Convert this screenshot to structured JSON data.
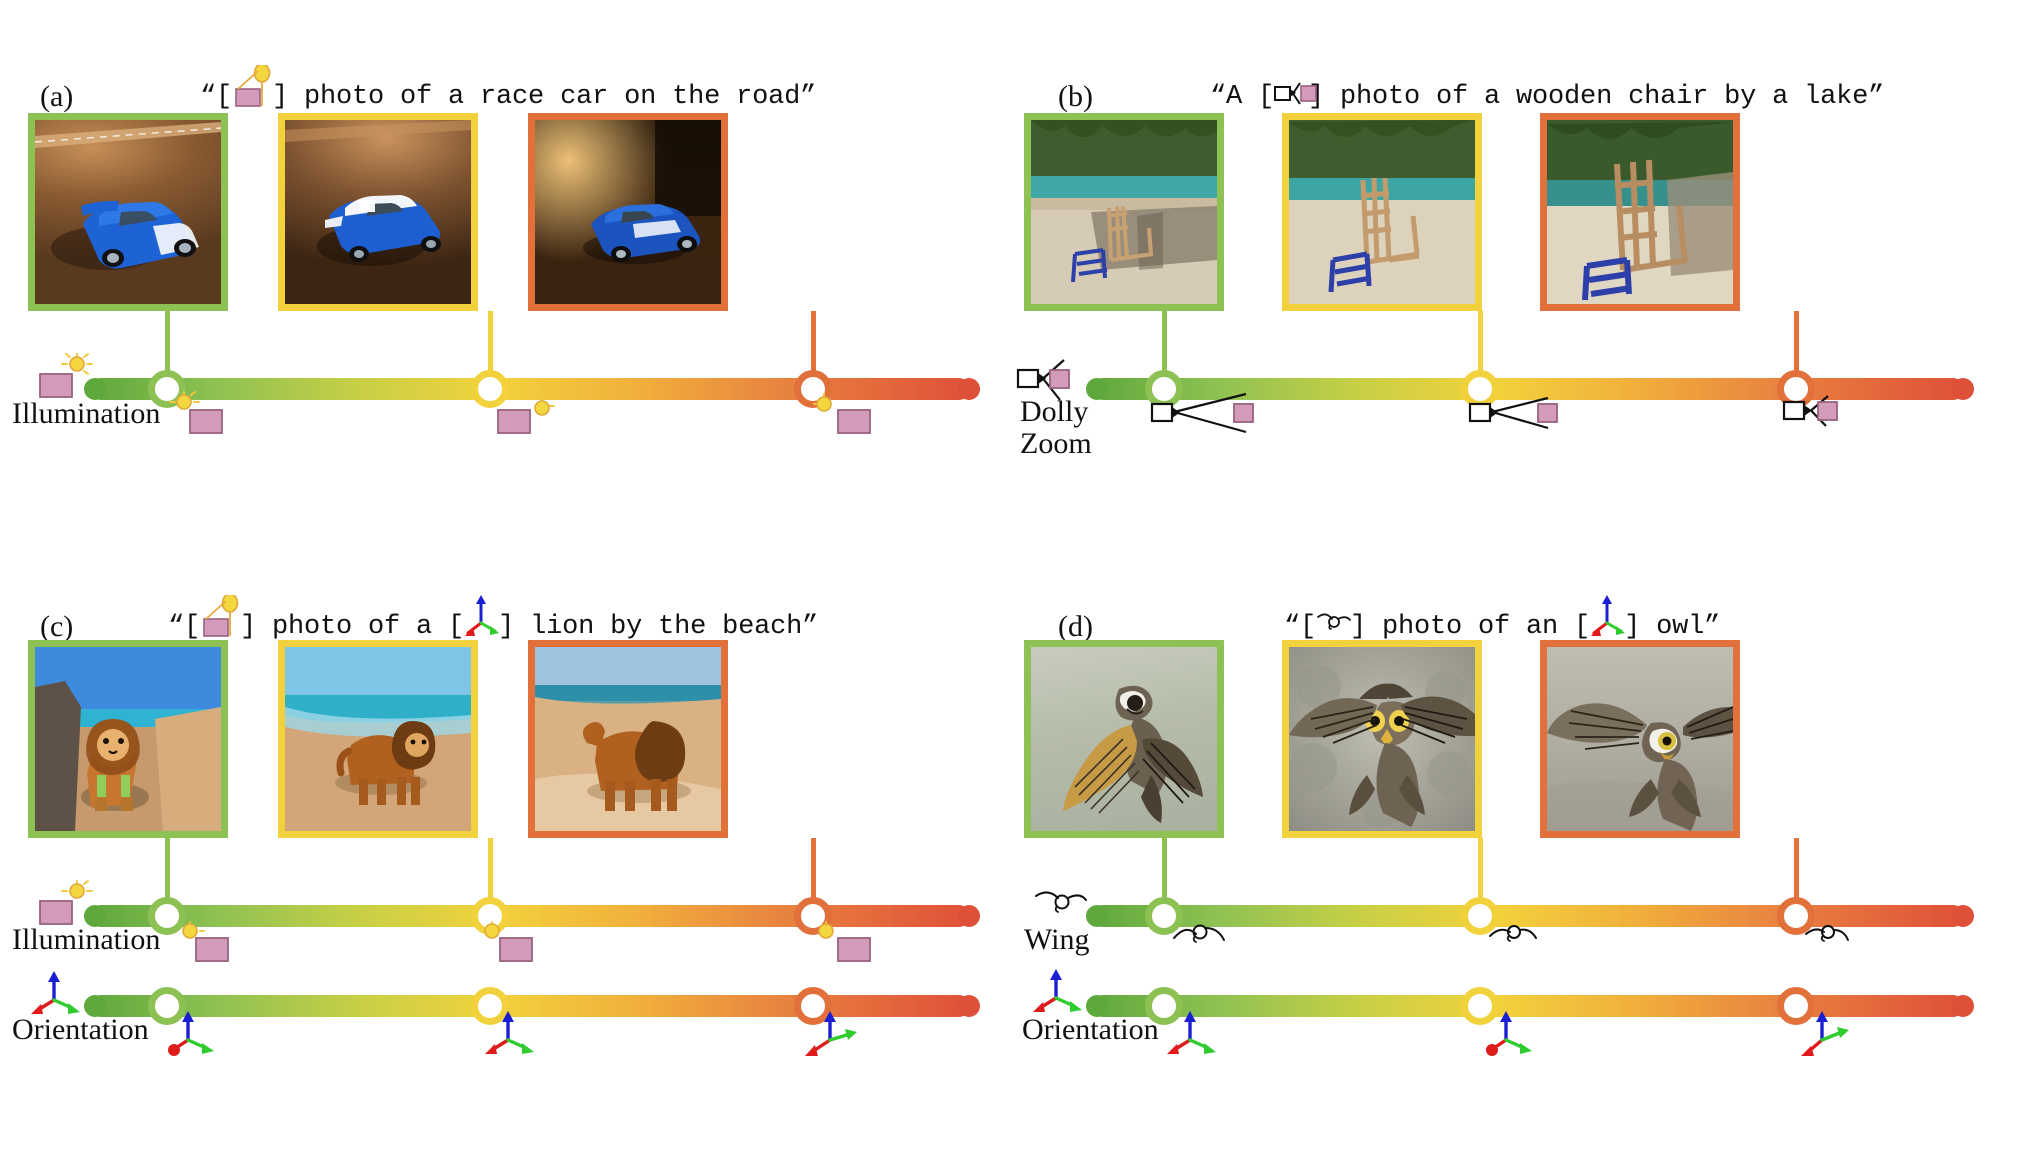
{
  "figure": {
    "background": "#ffffff",
    "palette": {
      "green": "#8DC153",
      "green_dark": "#5FA83C",
      "yellow": "#F2D23C",
      "orange": "#E88040",
      "red": "#DF5038",
      "pink": "#D39BBA",
      "sun": "#F4D63F",
      "axis_blue": "#1B1FD2",
      "axis_red": "#E01B1B",
      "axis_green": "#2ECC2E"
    }
  },
  "panels": [
    {
      "id": "a",
      "letter": "(a)",
      "caption_before": "“[",
      "caption_token": "illumination-token",
      "caption_after": "] photo of a race car on the road”",
      "caption_full": "“[☀] photo of a race car on the road”",
      "images": [
        {
          "name": "race-car-green",
          "border": "#8DC153",
          "alt": "blue race car on dirt road, bright daylight"
        },
        {
          "name": "race-car-yellow",
          "border": "#F2D23C",
          "alt": "blue and white race car on dirt road, warm light"
        },
        {
          "name": "race-car-red",
          "border": "#E2703A",
          "alt": "blue race car on dark road, low warm light"
        }
      ],
      "axes": [
        {
          "name": "illumination",
          "label": "Illumination",
          "icon": "sun-and-plane-icon",
          "nodes": [
            {
              "color": "#8DC153",
              "icon": "sun-plane-high"
            },
            {
              "color": "#F2D23C",
              "icon": "sun-plane-mid"
            },
            {
              "color": "#E2703A",
              "icon": "sun-plane-low"
            }
          ]
        }
      ]
    },
    {
      "id": "b",
      "letter": "(b)",
      "caption_before": "“A [",
      "caption_token": "dolly-zoom-token",
      "caption_after": "] photo of a wooden chair by a lake”",
      "caption_full": "“A [□◁] photo of a wooden chair by a lake”",
      "images": [
        {
          "name": "wooden-chair-green",
          "border": "#8DC153",
          "alt": "wooden chair by a lake, wide dolly view"
        },
        {
          "name": "wooden-chair-yellow",
          "border": "#F2D23C",
          "alt": "wooden chair by a lake, mid dolly view"
        },
        {
          "name": "wooden-chair-red",
          "border": "#E2703A",
          "alt": "wooden chair by a lake, close dolly view"
        }
      ],
      "axes": [
        {
          "name": "dolly-zoom",
          "label": "Dolly\nZoom",
          "label_line1": "Dolly",
          "label_line2": "Zoom",
          "icon": "camera-frustum-icon",
          "nodes": [
            {
              "color": "#8DC153",
              "icon": "camera-wide"
            },
            {
              "color": "#F2D23C",
              "icon": "camera-mid"
            },
            {
              "color": "#E2703A",
              "icon": "camera-narrow"
            }
          ]
        }
      ]
    },
    {
      "id": "c",
      "letter": "(c)",
      "caption_before": "“[",
      "caption_token": "illumination-token",
      "caption_mid": "] photo of a [",
      "caption_token2": "orientation-token",
      "caption_after": "] lion by the beach”",
      "caption_full": "“[☀] photo of a [✡] lion by the beach”",
      "images": [
        {
          "name": "lion-green",
          "border": "#8DC153",
          "alt": "lion on rocky beach facing camera, bright sky"
        },
        {
          "name": "lion-yellow",
          "border": "#F2D23C",
          "alt": "lion walking on beach, side three-quarter view"
        },
        {
          "name": "lion-red",
          "border": "#E2703A",
          "alt": "lion on beach at dusk, side profile view"
        }
      ],
      "axes": [
        {
          "name": "illumination",
          "label": "Illumination",
          "icon": "sun-and-plane-icon",
          "nodes": [
            {
              "color": "#8DC153",
              "icon": "sun-plane-high"
            },
            {
              "color": "#F2D23C",
              "icon": "sun-plane-mid"
            },
            {
              "color": "#E2703A",
              "icon": "sun-plane-low"
            }
          ]
        },
        {
          "name": "orientation",
          "label": "Orientation",
          "icon": "xyz-axes-icon",
          "nodes": [
            {
              "color": "#8DC153",
              "icon": "axes-front"
            },
            {
              "color": "#F2D23C",
              "icon": "axes-mid"
            },
            {
              "color": "#E2703A",
              "icon": "axes-side"
            }
          ]
        }
      ]
    },
    {
      "id": "d",
      "letter": "(d)",
      "caption_before": "“[",
      "caption_token": "wing-token",
      "caption_mid": "] photo of an [",
      "caption_token2": "orientation-token",
      "caption_after": "] owl”",
      "caption_full": "“[∿] photo of an [✡] owl”",
      "images": [
        {
          "name": "owl-green",
          "border": "#8DC153",
          "alt": "owl in flight, wings spread wide, side view"
        },
        {
          "name": "owl-yellow",
          "border": "#F2D23C",
          "alt": "owl in flight facing camera, wings raised"
        },
        {
          "name": "owl-red",
          "border": "#E2703A",
          "alt": "owl in flight, wings angled, light background"
        }
      ],
      "axes": [
        {
          "name": "wing",
          "label": "Wing",
          "icon": "wing-flap-icon",
          "nodes": [
            {
              "color": "#8DC153",
              "icon": "wing-up"
            },
            {
              "color": "#F2D23C",
              "icon": "wing-mid"
            },
            {
              "color": "#E2703A",
              "icon": "wing-down"
            }
          ]
        },
        {
          "name": "orientation",
          "label": "Orientation",
          "icon": "xyz-axes-icon",
          "nodes": [
            {
              "color": "#8DC153",
              "icon": "axes-front"
            },
            {
              "color": "#F2D23C",
              "icon": "axes-mid"
            },
            {
              "color": "#E2703A",
              "icon": "axes-side"
            }
          ]
        }
      ]
    }
  ]
}
